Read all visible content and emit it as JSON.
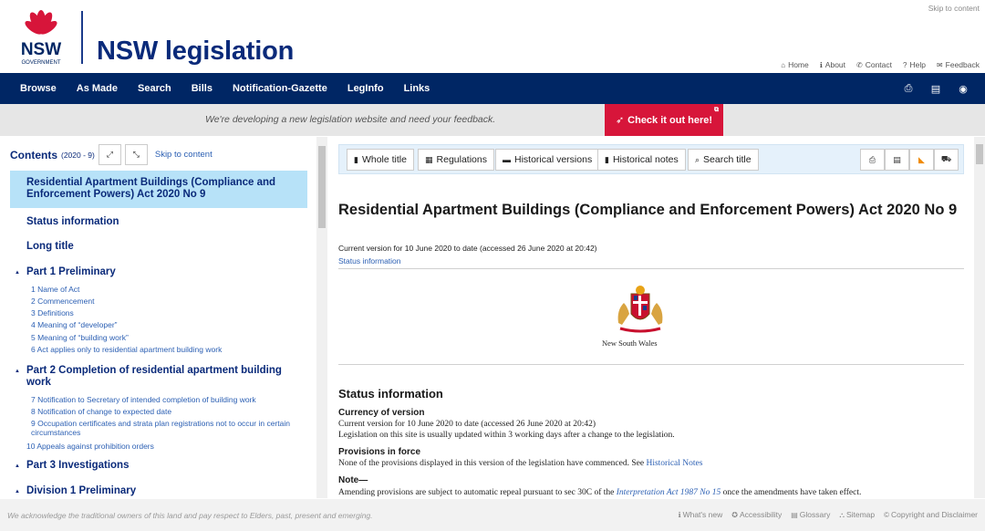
{
  "header": {
    "logo_word": "NSW",
    "logo_sub": "GOVERNMENT",
    "site_title": "NSW legislation",
    "skip_link": "Skip to content",
    "util_links": [
      {
        "icon": "home-icon",
        "glyph": "⌂",
        "label": "Home"
      },
      {
        "icon": "info-icon",
        "glyph": "ℹ",
        "label": "About"
      },
      {
        "icon": "phone-icon",
        "glyph": "✆",
        "label": "Contact"
      },
      {
        "icon": "help-icon",
        "glyph": "?",
        "label": "Help"
      },
      {
        "icon": "comment-icon",
        "glyph": "✉",
        "label": "Feedback"
      }
    ]
  },
  "nav": {
    "items": [
      "Browse",
      "As Made",
      "Search",
      "Bills",
      "Notification-Gazette",
      "LegInfo",
      "Links"
    ],
    "icons": [
      "pdf-icon",
      "print-icon",
      "user-icon"
    ]
  },
  "banner": {
    "text": "We're developing a new legislation website and need your feedback.",
    "button": "Check it out here!"
  },
  "toc": {
    "title": "Contents",
    "subtitle": "(2020 - 9)",
    "skip": "Skip to content",
    "active": "Residential Apartment Buildings (Compliance and Enforcement Powers) Act 2020 No 9",
    "status_info": "Status information",
    "long_title": "Long title",
    "part1": "Part 1 Preliminary",
    "part1_items": [
      "1 Name of Act",
      "2 Commencement",
      "3 Definitions",
      "4 Meaning of “developer”",
      "5 Meaning of “building work”",
      "6 Act applies only to residential apartment building work"
    ],
    "part2": "Part 2 Completion of residential apartment building work",
    "part2_items": [
      "7 Notification to Secretary of intended completion of building work",
      "8 Notification of change to expected date",
      "9 Occupation certificates and strata plan registrations not to occur in certain circumstances",
      "10 Appeals against prohibition orders"
    ],
    "part3": "Part 3 Investigations",
    "div1": "Division 1 Preliminary"
  },
  "toolbar": {
    "buttons": [
      {
        "icon": "book-icon",
        "glyph": "▮",
        "label": "Whole title"
      },
      {
        "icon": "building-icon",
        "glyph": "▦",
        "label": "Regulations"
      },
      {
        "icon": "archive-icon",
        "glyph": "▬",
        "label": "Historical versions"
      },
      {
        "icon": "notes-icon",
        "glyph": "▮",
        "label": "Historical notes"
      },
      {
        "icon": "search-icon",
        "glyph": "⌕",
        "label": "Search title"
      }
    ],
    "right_icons": [
      "pdf-icon",
      "word-doc-icon",
      "rss-icon",
      "truck-icon"
    ]
  },
  "main": {
    "title": "Residential Apartment Buildings (Compliance and Enforcement Powers) Act 2020 No 9",
    "current_version": "Current version for 10 June 2020 to date (accessed 26 June 2020 at 20:42)",
    "status_link": "Status information",
    "coat_caption": "New South Wales",
    "section_heading": "Status information",
    "currency_heading": "Currency of version",
    "currency_line1": "Current version for 10 June 2020 to date (accessed 26 June 2020 at 20:42)",
    "currency_line2": "Legislation on this site is usually updated within 3 working days after a change to the legislation.",
    "provisions_heading": "Provisions in force",
    "provisions_text": "None of the provisions displayed in this version of the legislation have commenced. See",
    "provisions_link": "Historical Notes",
    "note_heading": "Note—",
    "note_text_pre": "Amending provisions are subject to automatic repeal pursuant to sec 30C of the",
    "note_link": "Interpretation Act 1987 No 15",
    "note_text_post": "once the amendments have taken effect."
  },
  "footer": {
    "acknowledgement": "We acknowledge the traditional owners of this land and pay respect to Elders, past, present and emerging.",
    "links": [
      {
        "icon": "info-icon",
        "glyph": "ℹ",
        "label": "What's new"
      },
      {
        "icon": "accessibility-icon",
        "glyph": "✪",
        "label": "Accessibility"
      },
      {
        "icon": "glossary-icon",
        "glyph": "▤",
        "label": "Glossary"
      },
      {
        "icon": "sitemap-icon",
        "glyph": "⛬",
        "label": "Sitemap"
      },
      {
        "icon": "copyright-icon",
        "glyph": "©",
        "label": "Copyright and Disclaimer"
      }
    ]
  },
  "colors": {
    "navy": "#002664",
    "red": "#d7153a",
    "link": "#2b5fb3",
    "toc_active": "#b7e2f8"
  }
}
